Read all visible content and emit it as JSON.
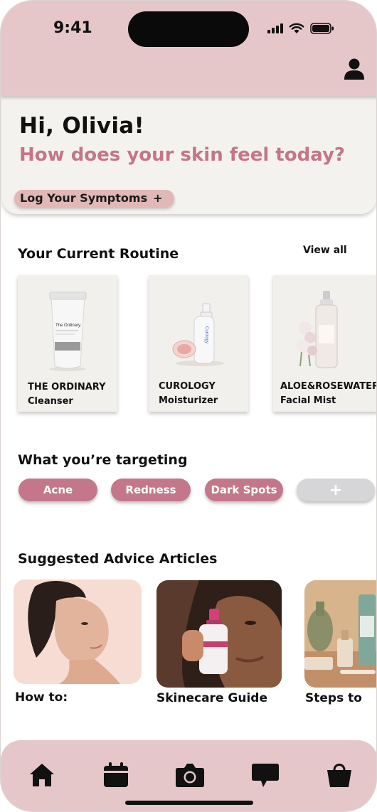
{
  "status_bar": {
    "time": "9:41"
  },
  "greeting": {
    "hello": "Hi,  Olivia!",
    "question": "How does your skin feel today?",
    "log_button": "Log Your Symptoms",
    "log_plus": "+"
  },
  "routine": {
    "title": "Your Current Routine",
    "view_all": "View all",
    "items": [
      {
        "brand": "THE ORDINARY",
        "type": "Cleanser"
      },
      {
        "brand": "CUROLOGY",
        "type": "Moisturizer"
      },
      {
        "brand": "ALOE&ROSEWATER",
        "type": "Facial Mist"
      }
    ]
  },
  "targeting": {
    "title": "What you’re targeting",
    "chips": [
      "Acne",
      "Redness",
      "Dark Spots"
    ],
    "add": "+"
  },
  "articles": {
    "title": "Suggested Advice Articles",
    "items": [
      {
        "label": "How to:"
      },
      {
        "label": "Skinecare Guide"
      },
      {
        "label": "Steps to"
      }
    ]
  },
  "nav": {
    "items": [
      "home-icon",
      "calendar-icon",
      "camera-icon",
      "chat-icon",
      "shopping-bag-icon"
    ]
  },
  "colors": {
    "header_bg": "#e5c7ca",
    "accent": "#c4768a",
    "card_bg": "#f2f0ec",
    "log_button_bg": "#e1b8b7"
  }
}
